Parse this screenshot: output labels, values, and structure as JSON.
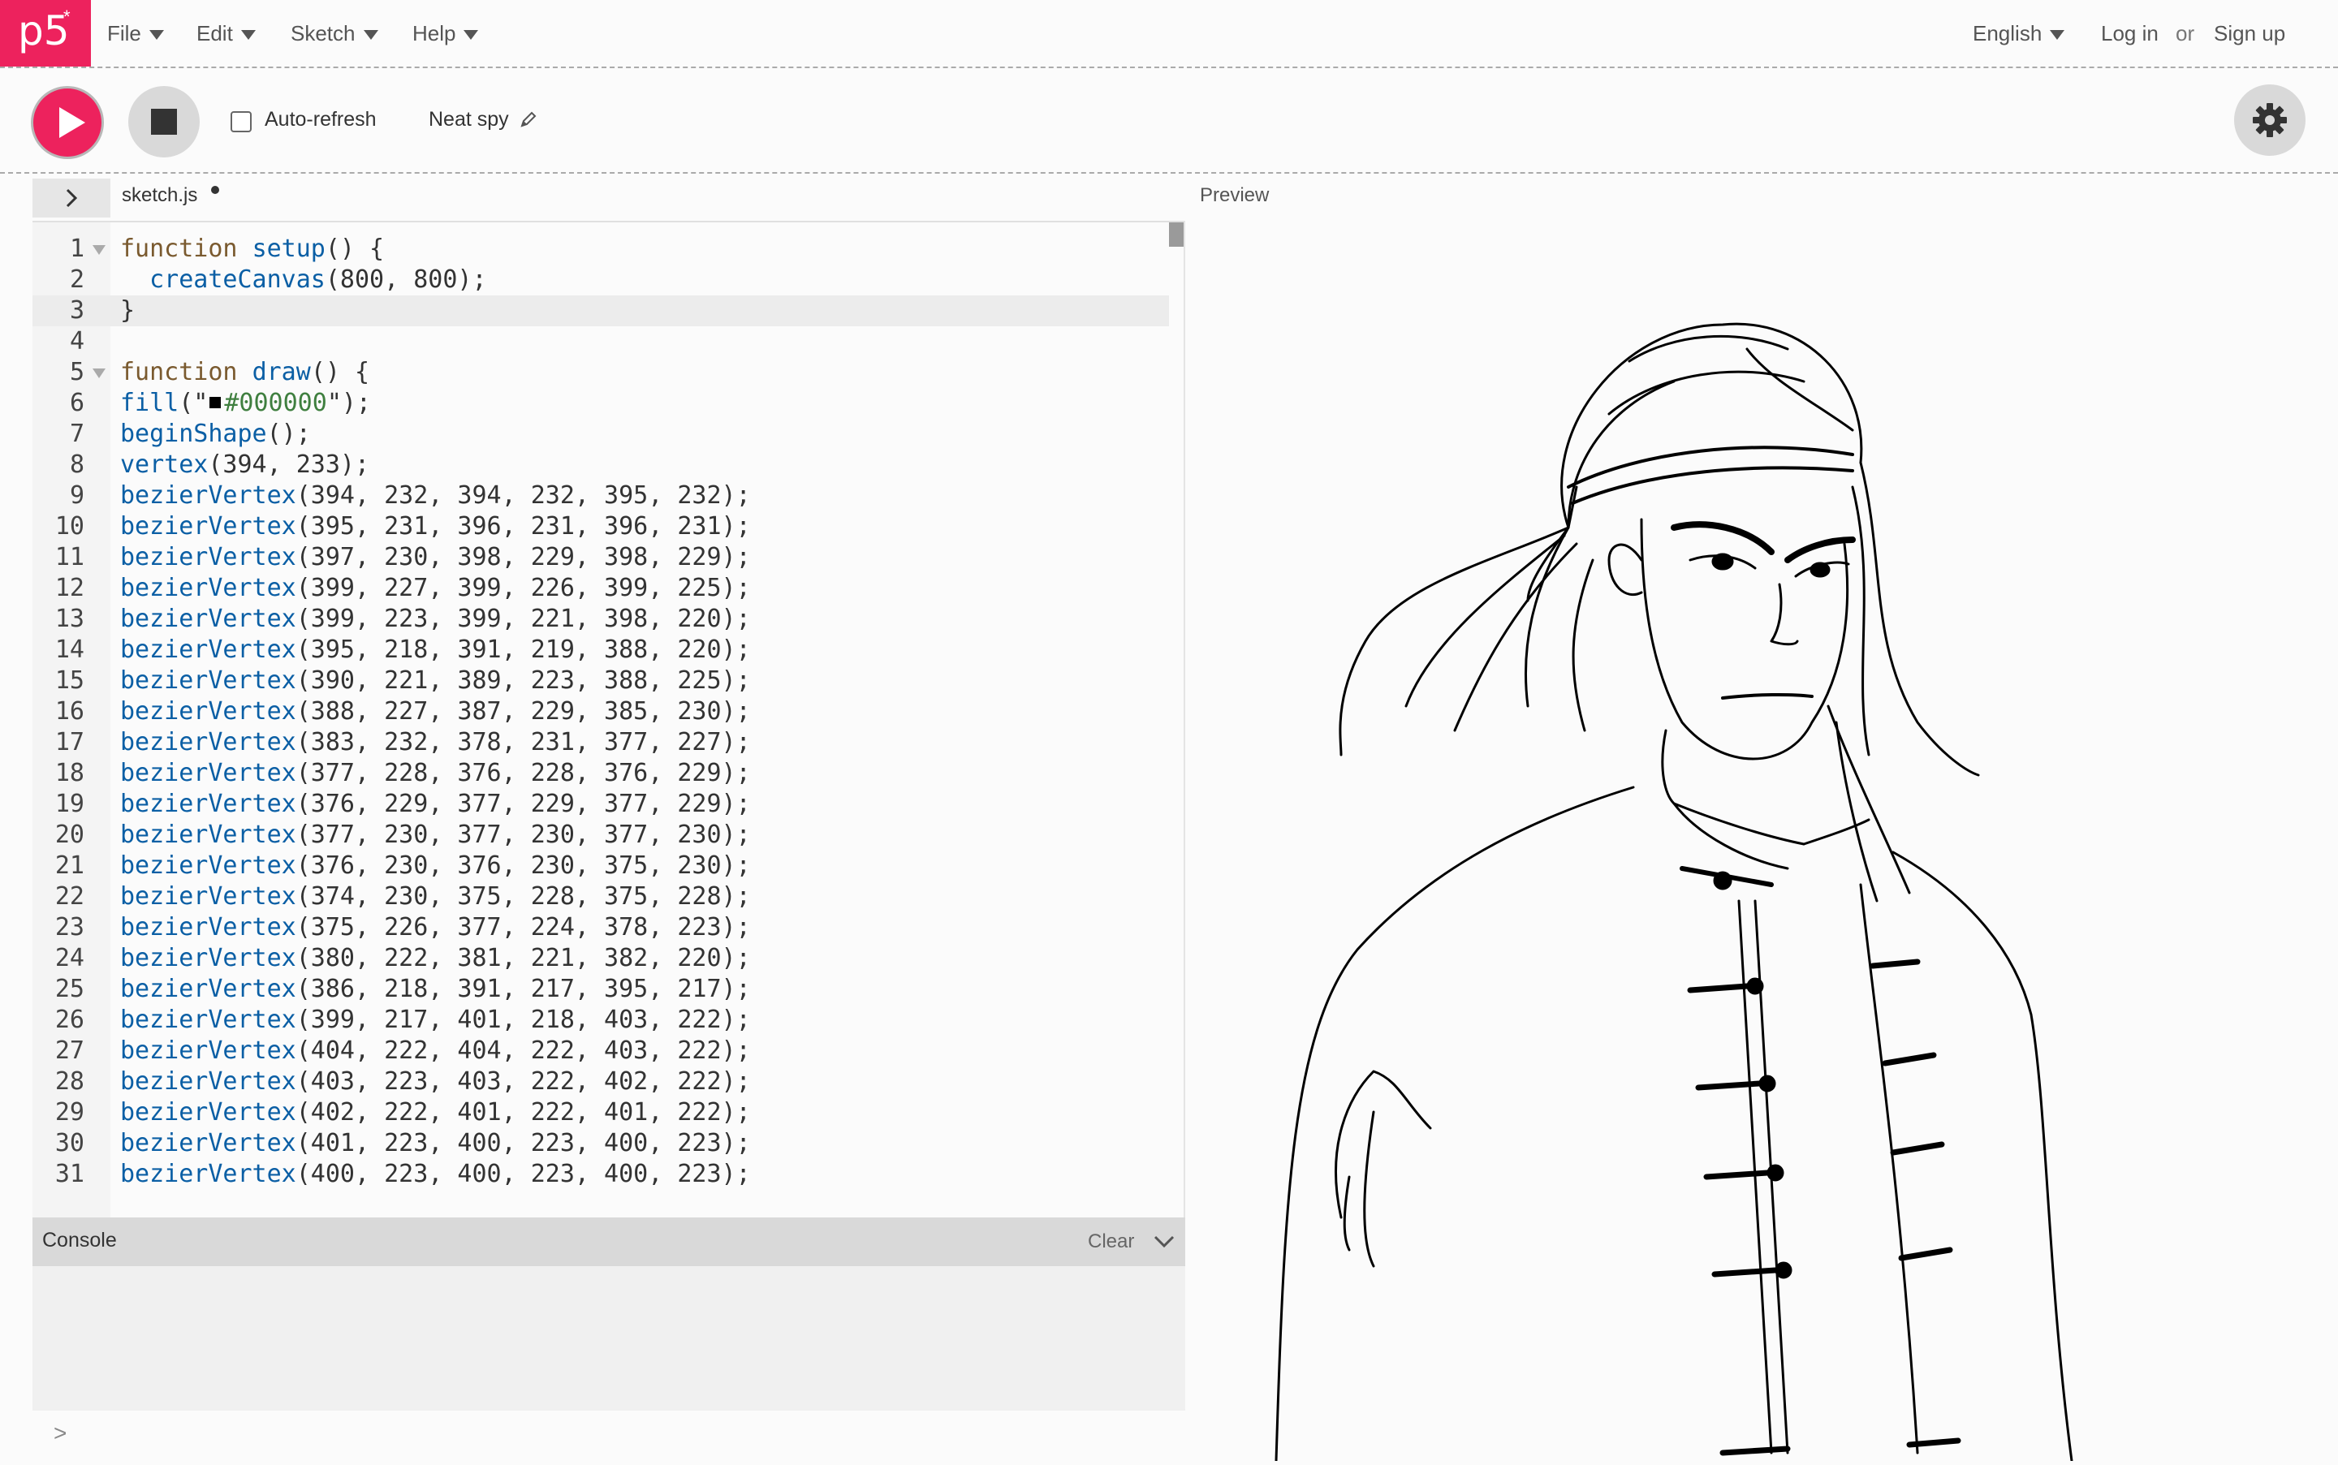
{
  "nav": {
    "logo": "p5",
    "logo_star": "*",
    "menus": [
      "File",
      "Edit",
      "Sketch",
      "Help"
    ],
    "language": "English",
    "login": "Log in",
    "or": "or",
    "signup": "Sign up"
  },
  "toolbar": {
    "auto_refresh_label": "Auto-refresh",
    "auto_refresh_checked": false,
    "sketch_name": "Neat spy"
  },
  "editor": {
    "file_tab": "sketch.js",
    "unsaved": true,
    "active_line": 2,
    "lines": [
      {
        "n": "1",
        "fold": true,
        "code": "function setup() {"
      },
      {
        "n": "2",
        "code": "  createCanvas(800, 800);"
      },
      {
        "n": "3",
        "code": "}"
      },
      {
        "n": "4",
        "code": ""
      },
      {
        "n": "5",
        "fold": true,
        "code": "function draw() {"
      },
      {
        "n": "6",
        "code": "fill(\"■#000000\");"
      },
      {
        "n": "7",
        "code": "beginShape();"
      },
      {
        "n": "8",
        "code": "vertex(394, 233);"
      },
      {
        "n": "9",
        "code": "bezierVertex(394, 232, 394, 232, 395, 232);"
      },
      {
        "n": "10",
        "code": "bezierVertex(395, 231, 396, 231, 396, 231);"
      },
      {
        "n": "11",
        "code": "bezierVertex(397, 230, 398, 229, 398, 229);"
      },
      {
        "n": "12",
        "code": "bezierVertex(399, 227, 399, 226, 399, 225);"
      },
      {
        "n": "13",
        "code": "bezierVertex(399, 223, 399, 221, 398, 220);"
      },
      {
        "n": "14",
        "code": "bezierVertex(395, 218, 391, 219, 388, 220);"
      },
      {
        "n": "15",
        "code": "bezierVertex(390, 221, 389, 223, 388, 225);"
      },
      {
        "n": "16",
        "code": "bezierVertex(388, 227, 387, 229, 385, 230);"
      },
      {
        "n": "17",
        "code": "bezierVertex(383, 232, 378, 231, 377, 227);"
      },
      {
        "n": "18",
        "code": "bezierVertex(377, 228, 376, 228, 376, 229);"
      },
      {
        "n": "19",
        "code": "bezierVertex(376, 229, 377, 229, 377, 229);"
      },
      {
        "n": "20",
        "code": "bezierVertex(377, 230, 377, 230, 377, 230);"
      },
      {
        "n": "21",
        "code": "bezierVertex(376, 230, 376, 230, 375, 230);"
      },
      {
        "n": "22",
        "code": "bezierVertex(374, 230, 375, 228, 375, 228);"
      },
      {
        "n": "23",
        "code": "bezierVertex(375, 226, 377, 224, 378, 223);"
      },
      {
        "n": "24",
        "code": "bezierVertex(380, 222, 381, 221, 382, 220);"
      },
      {
        "n": "25",
        "code": "bezierVertex(386, 218, 391, 217, 395, 217);"
      },
      {
        "n": "26",
        "code": "bezierVertex(399, 217, 401, 218, 403, 222);"
      },
      {
        "n": "27",
        "code": "bezierVertex(404, 222, 404, 222, 403, 222);"
      },
      {
        "n": "28",
        "code": "bezierVertex(403, 223, 403, 222, 402, 222);"
      },
      {
        "n": "29",
        "code": "bezierVertex(402, 222, 401, 222, 401, 222);"
      },
      {
        "n": "30",
        "code": "bezierVertex(401, 223, 400, 223, 400, 223);"
      },
      {
        "n": "31",
        "code": "bezierVertex(400, 223, 400, 223, 400, 223);"
      }
    ]
  },
  "console": {
    "title": "Console",
    "clear_label": "Clear",
    "prompt": ">"
  },
  "preview": {
    "label": "Preview"
  },
  "colors": {
    "brand": "#ed225d",
    "keyword": "#7a5a2f",
    "function": "#0b5fa5",
    "string": "#3f7f3f"
  }
}
